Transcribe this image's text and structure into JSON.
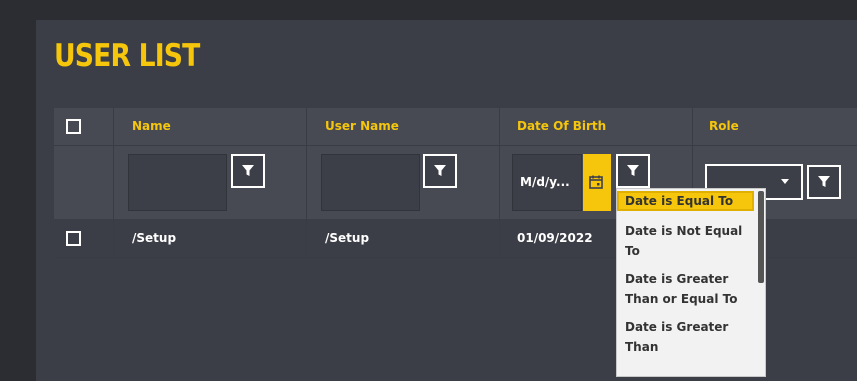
{
  "title": "USER LIST",
  "columns": [
    "Name",
    "User Name",
    "Date Of Birth",
    "Role"
  ],
  "filters": {
    "date_placeholder": "M/d/y..."
  },
  "rows": [
    {
      "name": "/Setup",
      "username": "/Setup",
      "dob": "01/09/2022"
    }
  ],
  "date_filter_menu": [
    "Date is Equal To",
    "Date is Not Equal To",
    "Date is Greater Than or Equal To",
    "Date is Greater Than"
  ],
  "colors": {
    "accent": "#f5c60c",
    "panel": "#3c3e47",
    "header": "#474a53"
  },
  "icons": [
    "filter-icon",
    "calendar-icon",
    "chevron-down-icon"
  ]
}
